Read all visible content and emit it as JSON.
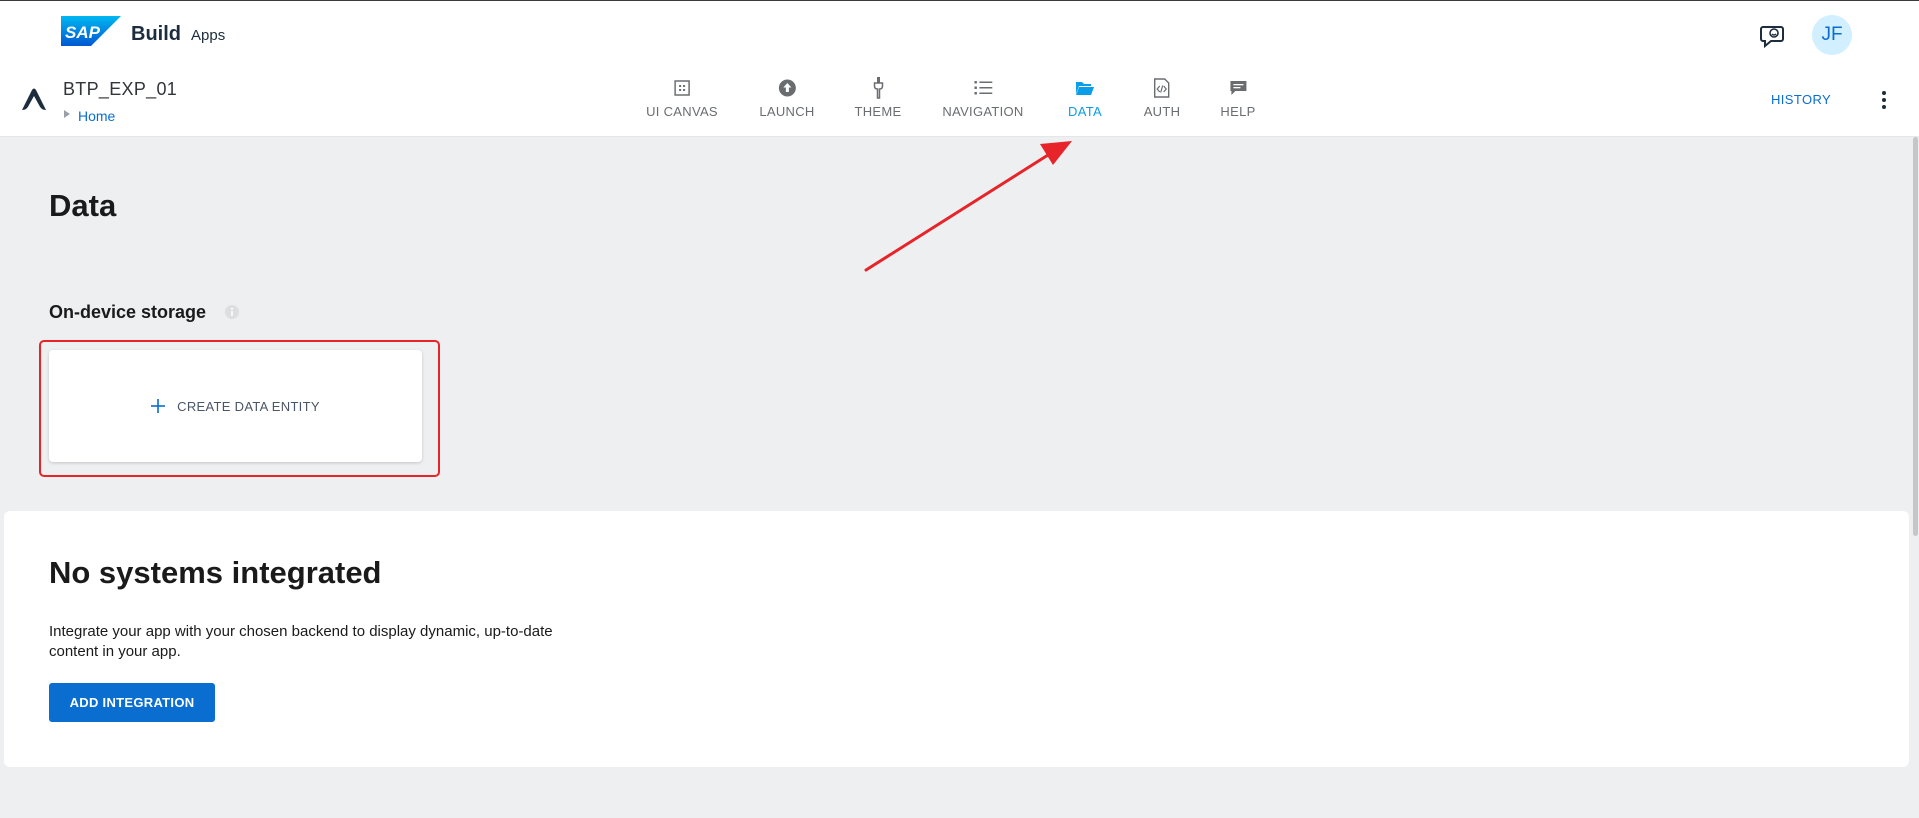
{
  "shell": {
    "logo_text": "SAP",
    "brand_primary": "Build",
    "brand_secondary": "Apps",
    "chat_icon": "chat-feedback-icon",
    "avatar_initials": "JF"
  },
  "app": {
    "name": "BTP_EXP_01",
    "breadcrumb_home": "Home",
    "logo_icon": "app-builder-logo"
  },
  "tabs": [
    {
      "id": "ui-canvas",
      "label": "UI CANVAS",
      "icon": "canvas-grid-icon",
      "active": false
    },
    {
      "id": "launch",
      "label": "LAUNCH",
      "icon": "upload-circle-icon",
      "active": false
    },
    {
      "id": "theme",
      "label": "THEME",
      "icon": "brush-icon",
      "active": false
    },
    {
      "id": "navigation",
      "label": "NAVIGATION",
      "icon": "list-icon",
      "active": false
    },
    {
      "id": "data",
      "label": "DATA",
      "icon": "folder-open-icon",
      "active": true
    },
    {
      "id": "auth",
      "label": "AUTH",
      "icon": "code-file-icon",
      "active": false
    },
    {
      "id": "help",
      "label": "HELP",
      "icon": "message-icon",
      "active": false
    }
  ],
  "header_actions": {
    "history_label": "HISTORY",
    "more_icon": "vertical-dots-icon"
  },
  "main": {
    "title": "Data",
    "storage_section_title": "On-device storage",
    "create_entity_label": "CREATE DATA ENTITY"
  },
  "integration": {
    "title": "No systems integrated",
    "description": "Integrate your app with your chosen backend to display dynamic, up-to-date content in your app.",
    "button_label": "ADD INTEGRATION"
  },
  "colors": {
    "accent": "#0a6ed1",
    "active_tab": "#0a9ee9",
    "annotation": "#e62429",
    "background": "#eeeff1"
  }
}
